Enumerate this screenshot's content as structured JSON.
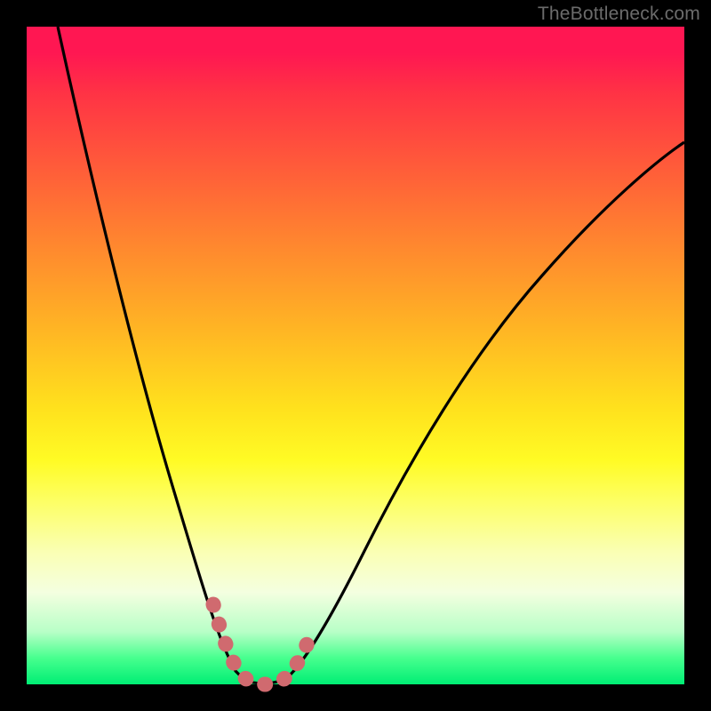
{
  "watermark": "TheBottleneck.com",
  "colors": {
    "frame": "#000000",
    "gradient_top": "#ff1752",
    "gradient_bottom": "#00ee74",
    "curve": "#000000",
    "marker": "#d06a6f"
  },
  "chart_data": {
    "type": "line",
    "title": "",
    "xlabel": "",
    "ylabel": "",
    "xlim": [
      0,
      100
    ],
    "ylim": [
      0,
      100
    ],
    "series": [
      {
        "name": "bottleneck-curve",
        "x": [
          0,
          5,
          10,
          15,
          20,
          23,
          26,
          29,
          31,
          33,
          35,
          37,
          40,
          45,
          50,
          55,
          60,
          65,
          70,
          75,
          80,
          85,
          90,
          95,
          100
        ],
        "y": [
          100,
          82,
          65,
          49,
          33,
          23,
          14,
          6,
          2,
          0,
          0,
          0,
          2,
          9,
          18,
          26,
          34,
          41,
          48,
          54,
          59,
          64,
          68,
          71,
          74
        ]
      }
    ],
    "markers": {
      "name": "bottom-highlight",
      "x": [
        26,
        28,
        30,
        32,
        34,
        36,
        38,
        40,
        42
      ],
      "y": [
        14,
        8,
        3,
        0,
        0,
        0,
        1,
        3,
        6
      ]
    }
  }
}
